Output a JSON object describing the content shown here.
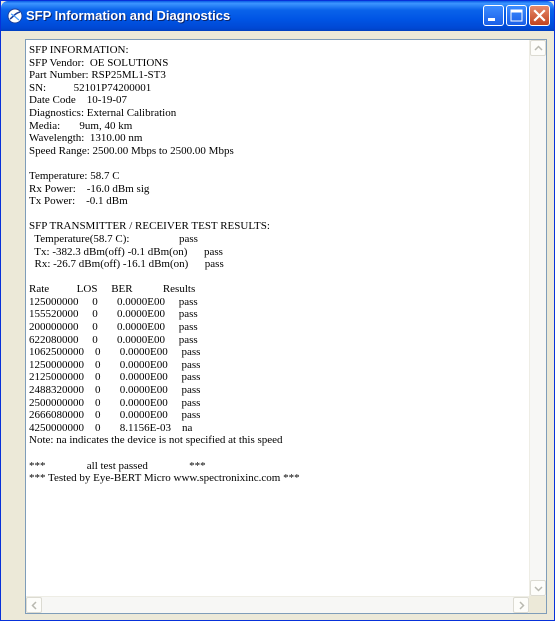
{
  "window": {
    "title": "SFP Information and Diagnostics"
  },
  "report": {
    "text": "SFP INFORMATION:\nSFP Vendor:  OE SOLUTIONS\nPart Number: RSP25ML1-ST3\nSN:          52101P74200001\nDate Code    10-19-07\nDiagnostics: External Calibration\nMedia:       9um, 40 km\nWavelength:  1310.00 nm\nSpeed Range: 2500.00 Mbps to 2500.00 Mbps\n\nTemperature: 58.7 C\nRx Power:    -16.0 dBm sig\nTx Power:    -0.1 dBm\n\nSFP TRANSMITTER / RECEIVER TEST RESULTS:\n  Temperature(58.7 C):                  pass\n  Tx: -382.3 dBm(off) -0.1 dBm(on)      pass\n  Rx: -26.7 dBm(off) -16.1 dBm(on)      pass\n\nRate          LOS     BER           Results\n125000000     0       0.0000E00     pass\n155520000     0       0.0000E00     pass\n200000000     0       0.0000E00     pass\n622080000     0       0.0000E00     pass\n1062500000    0       0.0000E00     pass\n1250000000    0       0.0000E00     pass\n2125000000    0       0.0000E00     pass\n2488320000    0       0.0000E00     pass\n2500000000    0       0.0000E00     pass\n2666080000    0       0.0000E00     pass\n4250000000    0       8.1156E-03    na\nNote: na indicates the device is not specified at this speed\n\n***               all test passed               ***\n*** Tested by Eye-BERT Micro www.spectronixinc.com ***"
  },
  "icons": {
    "app": "app-logo-icon",
    "minimize": "minimize-icon",
    "maximize": "maximize-icon",
    "close": "close-icon",
    "scroll_up": "scroll-up-arrow-icon",
    "scroll_down": "scroll-down-arrow-icon",
    "scroll_left": "scroll-left-arrow-icon",
    "scroll_right": "scroll-right-arrow-icon"
  },
  "colors": {
    "titlebar": "#0055e5",
    "close_button": "#c2431f",
    "border": "#7f9db9"
  }
}
